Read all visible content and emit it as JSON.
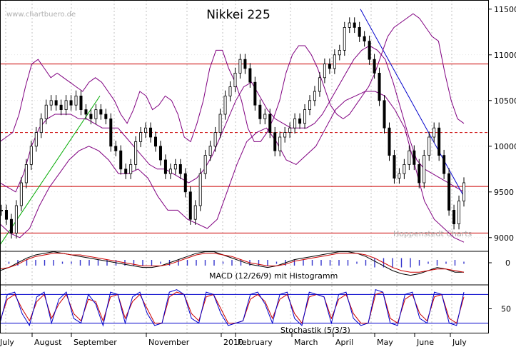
{
  "chart_data": {
    "type": "candlestick",
    "title": "Nikkei 225",
    "watermark": "www.chartbuero.de",
    "credit": "Hoppenstedt Charts",
    "x_axis": {
      "tick_labels": [
        "July",
        "August",
        "September",
        "November",
        "2010",
        "February",
        "March",
        "April",
        "May",
        "June",
        "July"
      ]
    },
    "price_panel": {
      "y_range": [
        8850,
        11600
      ],
      "y_ticks": [
        {
          "value": 11500,
          "label": "11500"
        },
        {
          "value": 11000,
          "label": "11000"
        },
        {
          "value": 10500,
          "label": "10500"
        },
        {
          "value": 10000,
          "label": "10000"
        },
        {
          "value": 9500,
          "label": "9500"
        },
        {
          "value": 9000,
          "label": "9000"
        }
      ],
      "horizontal_lines": [
        {
          "value": 10900,
          "style": "solid",
          "color": "#cc0000"
        },
        {
          "value": 10150,
          "style": "dashed",
          "color": "#cc0000"
        },
        {
          "value": 9560,
          "style": "solid",
          "color": "#cc0000"
        },
        {
          "value": 9050,
          "style": "solid",
          "color": "#cc0000"
        }
      ],
      "closes": [
        9300,
        9200,
        9050,
        9350,
        9600,
        9800,
        10000,
        10150,
        10300,
        10450,
        10500,
        10450,
        10400,
        10500,
        10450,
        10550,
        10400,
        10350,
        10300,
        10400,
        10350,
        10300,
        10000,
        9950,
        9750,
        9700,
        9800,
        10050,
        10150,
        10200,
        10100,
        10000,
        9850,
        9700,
        9750,
        9800,
        9700,
        9500,
        9200,
        9350,
        9700,
        9900,
        10000,
        10150,
        10350,
        10550,
        10650,
        10800,
        10950,
        10850,
        10700,
        10450,
        10300,
        10350,
        10150,
        9950,
        10100,
        10150,
        10200,
        10300,
        10250,
        10400,
        10500,
        10600,
        10750,
        10900,
        10850,
        11000,
        11050,
        11300,
        11350,
        11300,
        11200,
        11150,
        10950,
        10800,
        10500,
        10200,
        9900,
        9650,
        9700,
        9800,
        9950,
        9800,
        9600,
        9900,
        10100,
        10200,
        9900,
        9700,
        9300,
        9150,
        9400,
        9600
      ],
      "bollinger": {
        "upper": [
          10050,
          10100,
          10150,
          10350,
          10650,
          10900,
          10950,
          10850,
          10750,
          10800,
          10750,
          10700,
          10650,
          10600,
          10700,
          10750,
          10700,
          10600,
          10500,
          10350,
          10250,
          10400,
          10600,
          10550,
          10400,
          10450,
          10550,
          10500,
          10350,
          10100,
          10050,
          10250,
          10500,
          10850,
          11050,
          11050,
          10850,
          10700,
          10500,
          10200,
          10050,
          10050,
          10150,
          10300,
          10500,
          10800,
          11000,
          11100,
          11100,
          11000,
          10850,
          10650,
          10450,
          10350,
          10300,
          10350,
          10450,
          10550,
          10650,
          10800,
          11000,
          11200,
          11300,
          11350,
          11400,
          11450,
          11400,
          11300,
          11200,
          11150,
          10800,
          10500,
          10300,
          10250
        ],
        "middle": [
          9600,
          9550,
          9500,
          9700,
          10000,
          10200,
          10300,
          10350,
          10350,
          10350,
          10300,
          10300,
          10250,
          10200,
          10200,
          10200,
          10100,
          10000,
          9900,
          9800,
          9750,
          9750,
          9700,
          9650,
          9600,
          9650,
          9750,
          9900,
          10100,
          10300,
          10500,
          10650,
          10700,
          10550,
          10400,
          10300,
          10250,
          10200,
          10200,
          10200,
          10250,
          10350,
          10500,
          10650,
          10800,
          10950,
          11050,
          11100,
          11050,
          10950,
          10700,
          10400,
          10100,
          9850,
          9750,
          9700,
          9650,
          9600,
          9550,
          9500
        ],
        "lower": [
          9150,
          9050,
          9000,
          9100,
          9350,
          9550,
          9700,
          9850,
          9950,
          10000,
          9950,
          9850,
          9700,
          9700,
          9750,
          9650,
          9450,
          9300,
          9300,
          9200,
          9150,
          9100,
          9200,
          9500,
          9800,
          10050,
          10150,
          10200,
          10050,
          9850,
          9800,
          9900,
          10000,
          10200,
          10400,
          10500,
          10550,
          10600,
          10600,
          10550,
          10400,
          10200,
          9800,
          9400,
          9200,
          9100,
          9000,
          8950
        ]
      }
    },
    "macd_panel": {
      "label": "MACD (12/26/9) mit Histogramm",
      "tick_labels": [
        "0"
      ],
      "macd": [
        -5,
        -3,
        0,
        3,
        5,
        6,
        7,
        6,
        5,
        4,
        3,
        2,
        1,
        0,
        -1,
        -2,
        -3,
        -3,
        -2,
        0,
        2,
        4,
        6,
        7,
        7,
        5,
        3,
        1,
        -1,
        -2,
        -3,
        -2,
        0,
        2,
        3,
        4,
        5,
        6,
        7,
        7,
        6,
        4,
        1,
        -2,
        -5,
        -7,
        -8,
        -7,
        -5,
        -3,
        -4,
        -6,
        -6
      ],
      "signal": [
        -4,
        -3,
        -1,
        2,
        4,
        5,
        6,
        6,
        5,
        5,
        4,
        3,
        2,
        1,
        0,
        -1,
        -2,
        -2,
        -2,
        -1,
        1,
        3,
        5,
        6,
        6,
        5,
        4,
        2,
        0,
        -1,
        -2,
        -2,
        -1,
        1,
        2,
        3,
        4,
        5,
        6,
        6,
        6,
        5,
        3,
        0,
        -3,
        -5,
        -6,
        -6,
        -5,
        -4,
        -4,
        -5,
        -6
      ]
    },
    "stochastic_panel": {
      "label": "Stochastik (5/3/3)",
      "tick_labels": [
        "50"
      ],
      "upper_line": 80,
      "lower_line": 20,
      "k": [
        20,
        80,
        85,
        40,
        15,
        75,
        85,
        20,
        70,
        85,
        30,
        20,
        80,
        60,
        15,
        85,
        80,
        20,
        75,
        85,
        40,
        15,
        20,
        85,
        90,
        80,
        30,
        20,
        85,
        80,
        40,
        15,
        20,
        25,
        80,
        85,
        60,
        20,
        80,
        85,
        30,
        15,
        85,
        80,
        75,
        20,
        80,
        85,
        30,
        15,
        20,
        90,
        85,
        20,
        15,
        80,
        85,
        30,
        20,
        85,
        80,
        20,
        15,
        85
      ],
      "d": [
        25,
        70,
        80,
        50,
        25,
        65,
        80,
        30,
        60,
        80,
        40,
        25,
        70,
        65,
        25,
        75,
        80,
        30,
        65,
        80,
        50,
        20,
        20,
        75,
        85,
        80,
        40,
        25,
        75,
        80,
        50,
        20,
        20,
        25,
        70,
        80,
        65,
        30,
        70,
        80,
        40,
        20,
        75,
        80,
        75,
        30,
        70,
        80,
        40,
        20,
        20,
        80,
        85,
        30,
        20,
        70,
        80,
        40,
        25,
        75,
        80,
        30,
        20,
        75
      ]
    },
    "colors": {
      "price_bars": "#000000",
      "bollinger": "#800080",
      "trendline_up": "#00aa00",
      "trendline_down": "#0000cc",
      "support_resistance": "#cc0000",
      "macd_line": "#000000",
      "signal_line": "#cc0000",
      "histogram": "#3333cc",
      "stoch_k": "#0000cc",
      "stoch_d": "#cc0000",
      "grid": "#999999"
    }
  }
}
